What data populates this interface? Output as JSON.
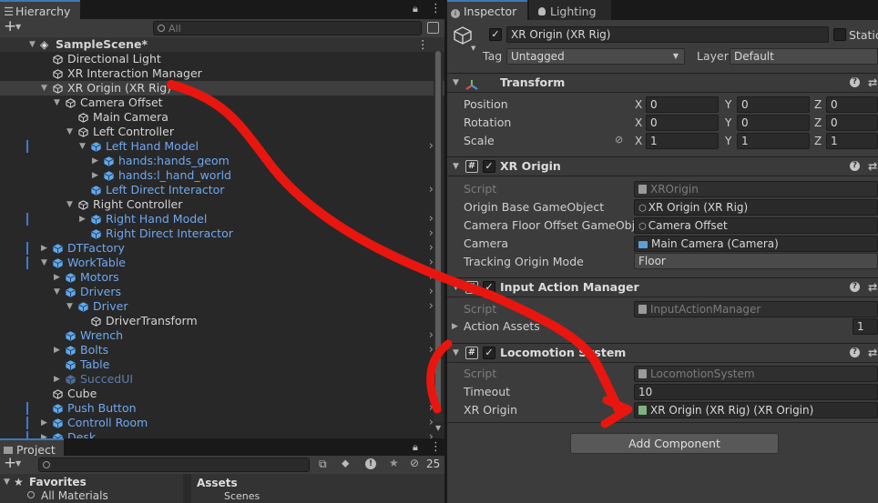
{
  "hierarchy": {
    "tab": "Hierarchy",
    "search_placeholder": "All",
    "scene": "SampleScene*",
    "rows": [
      {
        "label": "Directional Light",
        "depth": 1,
        "fold": "",
        "style": "normal",
        "chev": false,
        "mark": false
      },
      {
        "label": "XR Interaction Manager",
        "depth": 1,
        "fold": "",
        "style": "normal",
        "chev": false,
        "mark": false
      },
      {
        "label": "XR Origin (XR Rig)",
        "depth": 1,
        "fold": "▼",
        "style": "normal",
        "chev": false,
        "mark": false,
        "selected": true
      },
      {
        "label": "Camera Offset",
        "depth": 2,
        "fold": "▼",
        "style": "normal",
        "chev": false,
        "mark": false
      },
      {
        "label": "Main Camera",
        "depth": 3,
        "fold": "",
        "style": "normal",
        "chev": false,
        "mark": false
      },
      {
        "label": "Left Controller",
        "depth": 3,
        "fold": "▼",
        "style": "normal",
        "chev": false,
        "mark": false
      },
      {
        "label": "Left Hand Model",
        "depth": 4,
        "fold": "▼",
        "style": "prefab",
        "chev": true,
        "mark": true
      },
      {
        "label": "hands:hands_geom",
        "depth": 5,
        "fold": "▶",
        "style": "prefab",
        "chev": false,
        "mark": false
      },
      {
        "label": "hands:l_hand_world",
        "depth": 5,
        "fold": "▶",
        "style": "prefab",
        "chev": false,
        "mark": false
      },
      {
        "label": "Left Direct Interactor",
        "depth": 4,
        "fold": "",
        "style": "prefab",
        "chev": true,
        "mark": false
      },
      {
        "label": "Right Controller",
        "depth": 3,
        "fold": "▼",
        "style": "normal",
        "chev": false,
        "mark": false
      },
      {
        "label": "Right Hand Model",
        "depth": 4,
        "fold": "▶",
        "style": "prefab",
        "chev": true,
        "mark": true
      },
      {
        "label": "Right Direct Interactor",
        "depth": 4,
        "fold": "",
        "style": "prefab",
        "chev": true,
        "mark": false
      },
      {
        "label": "DTFactory",
        "depth": 1,
        "fold": "▶",
        "style": "prefab",
        "chev": true,
        "mark": true
      },
      {
        "label": "WorkTable",
        "depth": 1,
        "fold": "▼",
        "style": "prefab",
        "chev": true,
        "mark": true
      },
      {
        "label": "Motors",
        "depth": 2,
        "fold": "▶",
        "style": "prefab",
        "chev": true,
        "mark": false
      },
      {
        "label": "Drivers",
        "depth": 2,
        "fold": "▼",
        "style": "prefab",
        "chev": true,
        "mark": false
      },
      {
        "label": "Driver",
        "depth": 3,
        "fold": "▼",
        "style": "prefab",
        "chev": true,
        "mark": false
      },
      {
        "label": "DriverTransform",
        "depth": 4,
        "fold": "",
        "style": "normal",
        "chev": false,
        "mark": false
      },
      {
        "label": "Wrench",
        "depth": 2,
        "fold": "",
        "style": "prefab",
        "chev": true,
        "mark": false
      },
      {
        "label": "Bolts",
        "depth": 2,
        "fold": "▶",
        "style": "prefab",
        "chev": true,
        "mark": false
      },
      {
        "label": "Table",
        "depth": 2,
        "fold": "",
        "style": "prefab",
        "chev": true,
        "mark": false
      },
      {
        "label": "SuccedUI",
        "depth": 2,
        "fold": "▶",
        "style": "dim",
        "chev": true,
        "mark": false
      },
      {
        "label": "Cube",
        "depth": 1,
        "fold": "",
        "style": "normal",
        "chev": false,
        "mark": false
      },
      {
        "label": "Push Button",
        "depth": 1,
        "fold": "",
        "style": "prefab",
        "chev": true,
        "mark": true
      },
      {
        "label": "Controll Room",
        "depth": 1,
        "fold": "▶",
        "style": "prefab",
        "chev": true,
        "mark": true
      },
      {
        "label": "Desk",
        "depth": 1,
        "fold": "▶",
        "style": "prefab",
        "chev": true,
        "mark": true
      }
    ]
  },
  "project": {
    "tab": "Project",
    "count": "25",
    "favorites": "Favorites",
    "all_materials": "All Materials",
    "assets": "Assets",
    "scenes": "Scenes"
  },
  "inspector": {
    "tab_inspector": "Inspector",
    "tab_lighting": "Lighting",
    "object_name": "XR Origin (XR Rig)",
    "static_label": "Static",
    "tag_label": "Tag",
    "tag_value": "Untagged",
    "layer_label": "Layer",
    "layer_value": "Default",
    "transform": {
      "title": "Transform",
      "position_label": "Position",
      "rotation_label": "Rotation",
      "scale_label": "Scale",
      "axes": [
        "X",
        "Y",
        "Z"
      ],
      "position": [
        "0",
        "0",
        "0"
      ],
      "rotation": [
        "0",
        "0",
        "0"
      ],
      "scale": [
        "1",
        "1",
        "1"
      ]
    },
    "xr_origin": {
      "title": "XR Origin",
      "script_label": "Script",
      "script_value": "XROrigin",
      "origin_label": "Origin Base GameObject",
      "origin_value": "XR Origin (XR Rig)",
      "floor_label": "Camera Floor Offset GameObject",
      "floor_value": "Camera Offset",
      "camera_label": "Camera",
      "camera_value": "Main Camera (Camera)",
      "tracking_label": "Tracking Origin Mode",
      "tracking_value": "Floor"
    },
    "input_action_manager": {
      "title": "Input Action Manager",
      "script_label": "Script",
      "script_value": "InputActionManager",
      "assets_label": "Action Assets",
      "assets_value": "1"
    },
    "locomotion": {
      "title": "Locomotion System",
      "script_label": "Script",
      "script_value": "LocomotionSystem",
      "timeout_label": "Timeout",
      "timeout_value": "10",
      "xrorigin_label": "XR Origin",
      "xrorigin_value": "XR Origin (XR Rig) (XR Origin)"
    },
    "add_component": "Add Component"
  },
  "annotation": {
    "color": "#e8160f"
  }
}
